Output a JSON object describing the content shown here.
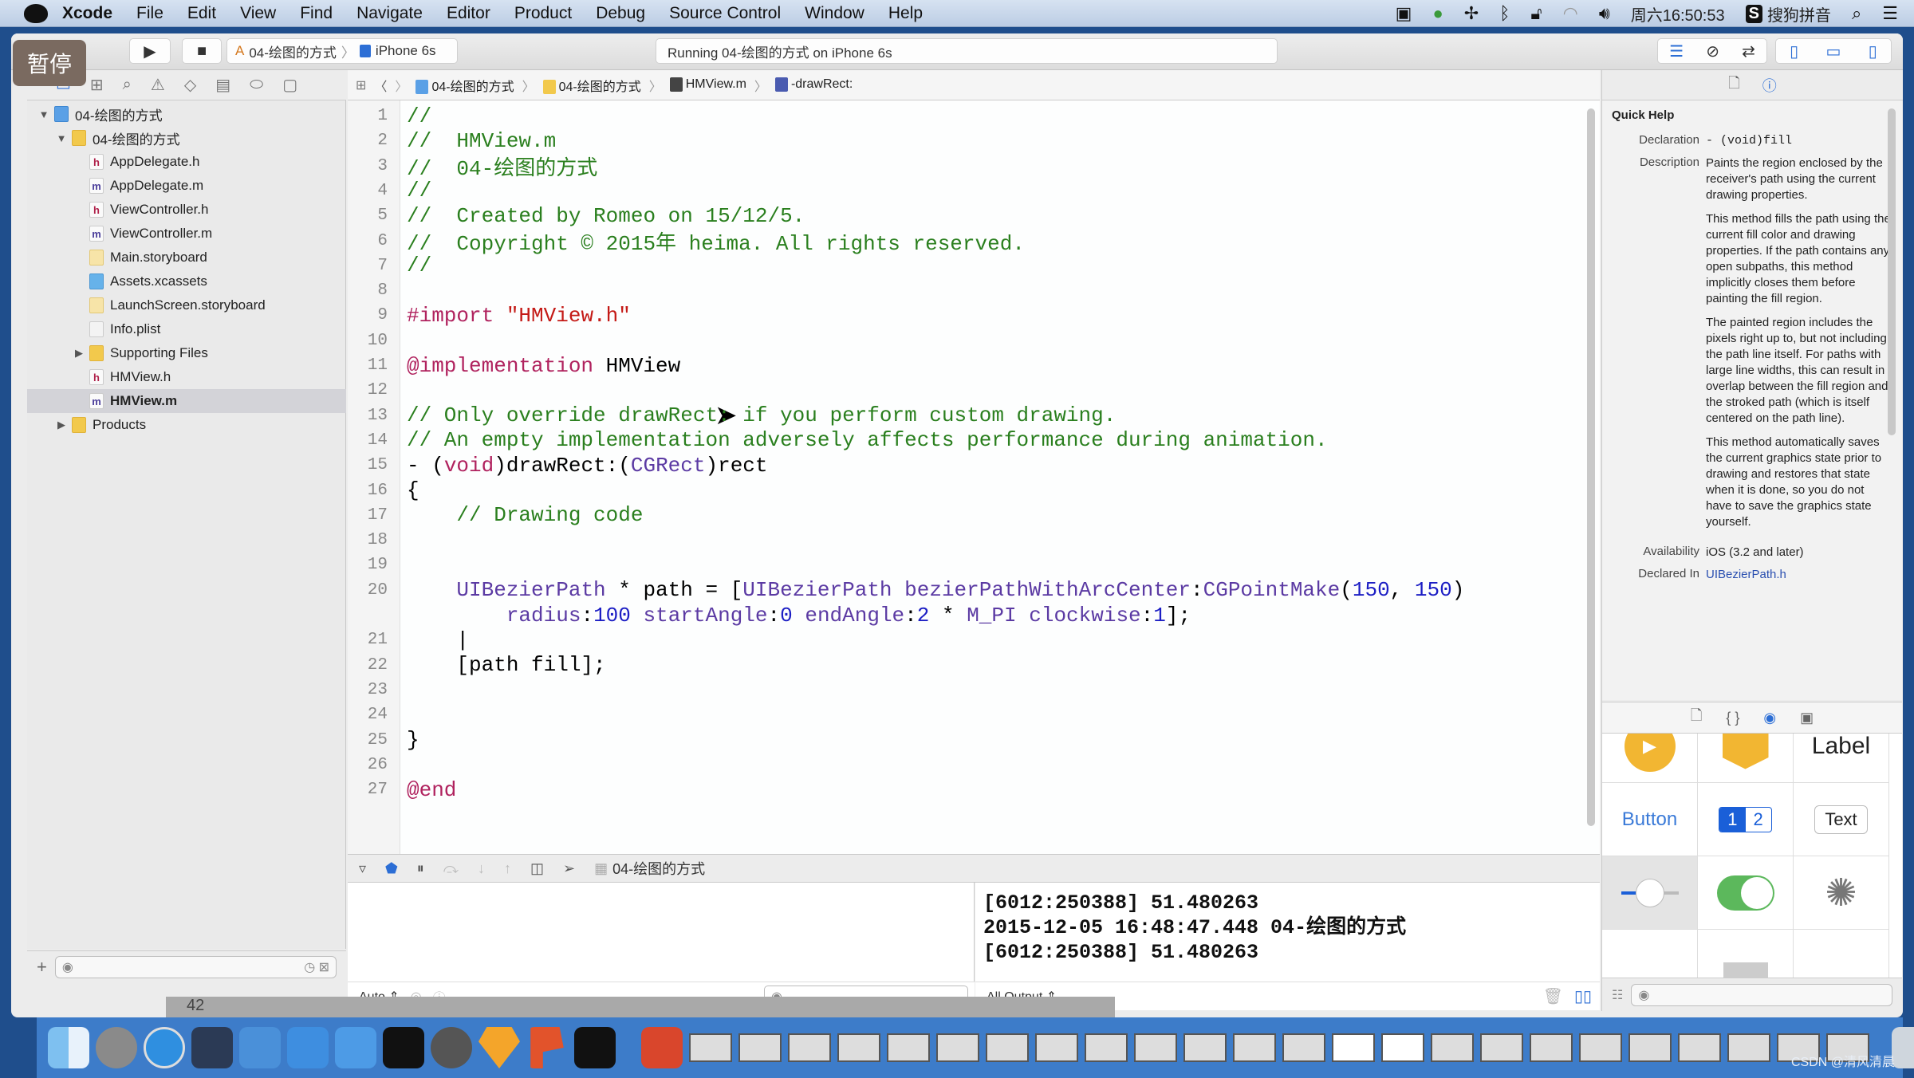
{
  "menubar": {
    "app": "Xcode",
    "items": [
      "File",
      "Edit",
      "View",
      "Find",
      "Navigate",
      "Editor",
      "Product",
      "Debug",
      "Source Control",
      "Window",
      "Help"
    ],
    "clock": "周六16:50:53",
    "input_method": "搜狗拼音",
    "status_icons": [
      "screen-record-icon",
      "player-icon",
      "fan-icon",
      "bluetooth-icon",
      "lock-icon",
      "wifi-icon",
      "volume-icon"
    ]
  },
  "overlay": {
    "pause_label": "暂停"
  },
  "toolbar": {
    "scheme": "04-绘图的方式",
    "device": "iPhone 6s",
    "status": "Running 04-绘图的方式 on iPhone 6s"
  },
  "navigator": {
    "tabs": [
      "project-icon",
      "symbol-icon",
      "find-icon",
      "issue-icon",
      "test-icon",
      "debug-icon",
      "breakpoint-icon",
      "report-icon"
    ],
    "tree": [
      {
        "label": "04-绘图的方式",
        "type": "proj",
        "level": 0,
        "disclosure": "open"
      },
      {
        "label": "04-绘图的方式",
        "type": "folder",
        "level": 1,
        "disclosure": "open"
      },
      {
        "label": "AppDelegate.h",
        "type": "h",
        "level": 2
      },
      {
        "label": "AppDelegate.m",
        "type": "m",
        "level": 2
      },
      {
        "label": "ViewController.h",
        "type": "h",
        "level": 2
      },
      {
        "label": "ViewController.m",
        "type": "m",
        "level": 2
      },
      {
        "label": "Main.storyboard",
        "type": "sb",
        "level": 2
      },
      {
        "label": "Assets.xcassets",
        "type": "assets",
        "level": 2
      },
      {
        "label": "LaunchScreen.storyboard",
        "type": "sb",
        "level": 2
      },
      {
        "label": "Info.plist",
        "type": "plist",
        "level": 2
      },
      {
        "label": "Supporting Files",
        "type": "folder",
        "level": 2,
        "disclosure": "closed"
      },
      {
        "label": "HMView.h",
        "type": "h",
        "level": 2
      },
      {
        "label": "HMView.m",
        "type": "m",
        "level": 2,
        "selected": true
      },
      {
        "label": "Products",
        "type": "folder",
        "level": 1,
        "disclosure": "closed"
      }
    ]
  },
  "jumpbar": {
    "crumbs": [
      "04-绘图的方式",
      "04-绘图的方式",
      "HMView.m",
      "-drawRect:"
    ]
  },
  "editor": {
    "lines": [
      {
        "n": "1",
        "html": "<span class='cm'>//</span>"
      },
      {
        "n": "2",
        "html": "<span class='cm'>//  HMView.m</span>"
      },
      {
        "n": "3",
        "html": "<span class='cm'>//  04-绘图的方式</span>"
      },
      {
        "n": "4",
        "html": "<span class='cm'>//</span>"
      },
      {
        "n": "5",
        "html": "<span class='cm'>//  Created by Romeo on 15/12/5.</span>"
      },
      {
        "n": "6",
        "html": "<span class='cm'>//  Copyright © 2015年 heima. All rights reserved.</span>"
      },
      {
        "n": "7",
        "html": "<span class='cm'>//</span>"
      },
      {
        "n": "8",
        "html": ""
      },
      {
        "n": "9",
        "html": "<span class='kw'>#import</span> <span class='str'>\"HMView.h\"</span>"
      },
      {
        "n": "10",
        "html": ""
      },
      {
        "n": "11",
        "html": "<span class='kw'>@implementation</span> HMView"
      },
      {
        "n": "12",
        "html": ""
      },
      {
        "n": "13",
        "html": "<span class='cm'>// Only override drawRect: if you perform custom drawing.</span>"
      },
      {
        "n": "14",
        "html": "<span class='cm'>// An empty implementation adversely affects performance during animation.</span>"
      },
      {
        "n": "15",
        "html": "- (<span class='kw'>void</span>)drawRect:(<span class='ty'>CGRect</span>)rect"
      },
      {
        "n": "16",
        "html": "{"
      },
      {
        "n": "17",
        "html": "    <span class='cm'>// Drawing code</span>"
      },
      {
        "n": "18",
        "html": ""
      },
      {
        "n": "19",
        "html": ""
      },
      {
        "n": "20",
        "html": "    <span class='ty'>UIBezierPath</span> * path = [<span class='ty'>UIBezierPath</span> <span class='ty'>bezierPathWithArcCenter</span>:<span class='ty'>CGPointMake</span>(<span class='num'>150</span>, <span class='num'>150</span>)"
      },
      {
        "n": "",
        "html": "        <span class='ty'>radius</span>:<span class='num'>100</span> <span class='ty'>startAngle</span>:<span class='num'>0</span> <span class='ty'>endAngle</span>:<span class='num'>2</span> * <span class='ty'>M_PI</span> <span class='ty'>clockwise</span>:<span class='num'>1</span>];"
      },
      {
        "n": "21",
        "html": "    |"
      },
      {
        "n": "22",
        "html": "    [path fill];"
      },
      {
        "n": "23",
        "html": ""
      },
      {
        "n": "24",
        "html": ""
      },
      {
        "n": "25",
        "html": "}"
      },
      {
        "n": "26",
        "html": ""
      },
      {
        "n": "27",
        "html": "<span class='kw'>@end</span>"
      }
    ]
  },
  "debug": {
    "process": "04-绘图的方式",
    "variables_mode": "Auto",
    "output_filter": "All Output",
    "console_lines": [
      "[6012:250388] 51.480263",
      "2015-12-05 16:48:47.448 04-绘图的方式",
      "[6012:250388] 51.480263"
    ]
  },
  "quick_help": {
    "title": "Quick Help",
    "declaration_label": "Declaration",
    "declaration": "- (void)fill",
    "description_label": "Description",
    "paragraphs": [
      "Paints the region enclosed by the receiver's path using the current drawing properties.",
      "This method fills the path using the current fill color and drawing properties. If the path contains any open subpaths, this method implicitly closes them before painting the fill region.",
      "The painted region includes the pixels right up to, but not including, the path line itself. For paths with large line widths, this can result in overlap between the fill region and the stroked path (which is itself centered on the path line).",
      "This method automatically saves the current graphics state prior to drawing and restores that state when it is done, so you do not have to save the graphics state yourself."
    ],
    "availability_label": "Availability",
    "availability": "iOS (3.2 and later)",
    "declared_in_label": "Declared In",
    "declared_in": "UIBezierPath.h"
  },
  "library": {
    "label_item": "Label",
    "button_item": "Button",
    "segment_1": "1",
    "segment_2": "2",
    "text_item": "Text"
  },
  "dock": {
    "strip_number": "42"
  },
  "watermark": "CSDN @清风清晨",
  "colors": {
    "accent": "#2c6ed5",
    "comment": "#2a7f1e",
    "keyword": "#b0225e"
  }
}
